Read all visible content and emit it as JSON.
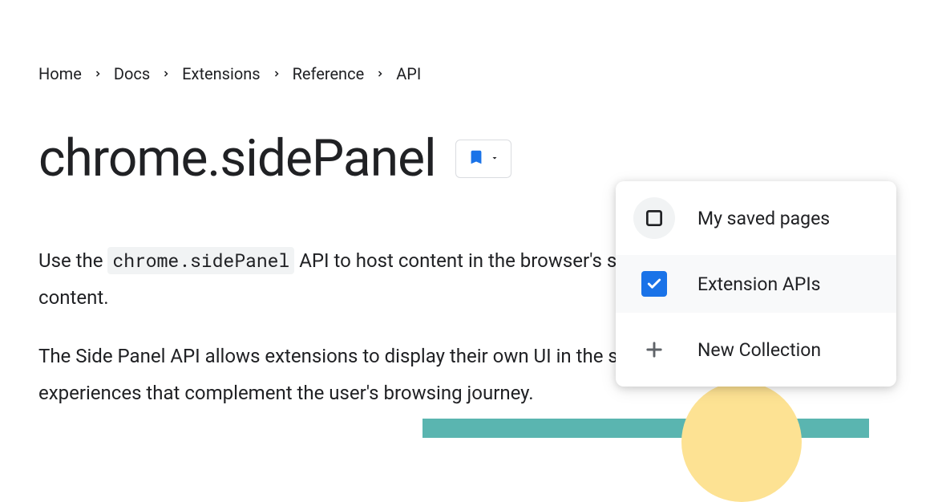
{
  "breadcrumb": {
    "items": [
      {
        "label": "Home"
      },
      {
        "label": "Docs"
      },
      {
        "label": "Extensions"
      },
      {
        "label": "Reference"
      },
      {
        "label": "API"
      }
    ]
  },
  "page_title": "chrome.sidePanel",
  "intro": {
    "prefix": "Use the ",
    "code": "chrome.sidePanel",
    "suffix": " API to host content in the browser's side panel alongside the main content."
  },
  "paragraph2": "The Side Panel API allows extensions to display their own UI in the side panel, enabling persistent experiences that complement the user's browsing journey.",
  "dropdown": {
    "items": [
      {
        "label": "My saved pages",
        "checked": false
      },
      {
        "label": "Extension APIs",
        "checked": true
      },
      {
        "label": "New Collection",
        "action": true
      }
    ]
  }
}
